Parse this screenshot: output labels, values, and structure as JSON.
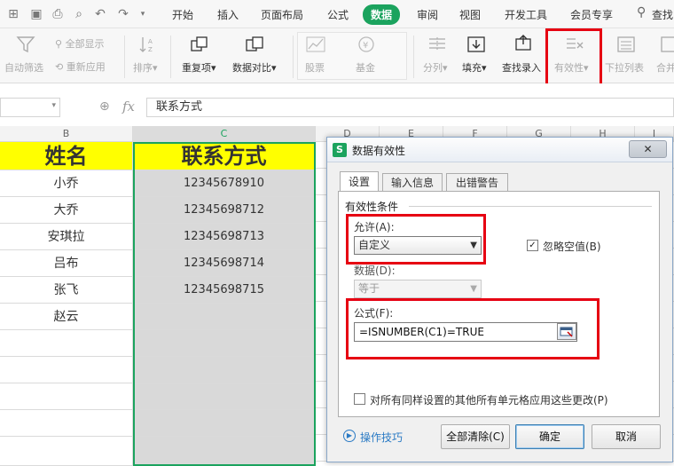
{
  "menu": {
    "tabs": [
      "开始",
      "插入",
      "页面布局",
      "公式",
      "数据",
      "审阅",
      "视图",
      "开发工具",
      "会员专享"
    ],
    "active_tab": "数据",
    "search_label": "查找"
  },
  "ribbon": {
    "auto_filter": "自动筛选",
    "show_all": "全部显示",
    "reapply": "重新应用",
    "sort": "排序",
    "duplicates": "重复项",
    "compare": "数据对比",
    "stocks": "股票",
    "funds": "基金",
    "split": "分列",
    "fill": "填充",
    "lookup_entry": "查找录入",
    "validity": "有效性",
    "dropdown_list": "下拉列表",
    "merge": "合并"
  },
  "formula_bar": {
    "fx": "fx",
    "content": "联系方式"
  },
  "sheet": {
    "columns": [
      "B",
      "C",
      "D",
      "E",
      "F",
      "G",
      "H",
      "I"
    ],
    "header_name": "姓名",
    "header_contact": "联系方式",
    "names": [
      "小乔",
      "大乔",
      "安琪拉",
      "吕布",
      "张飞",
      "赵云"
    ],
    "phones": [
      "12345678910",
      "12345698712",
      "12345698713",
      "12345698714",
      "12345698715"
    ]
  },
  "dialog": {
    "title": "数据有效性",
    "close": "✕",
    "tabs": [
      "设置",
      "输入信息",
      "出错警告"
    ],
    "section": "有效性条件",
    "allow_label": "允许(A):",
    "allow_value": "自定义",
    "ignore_blank": "忽略空值(B)",
    "data_label": "数据(D):",
    "data_value": "等于",
    "formula_label": "公式(F):",
    "formula_value": "=ISNUMBER(C1)=TRUE",
    "apply_all": "对所有同样设置的其他所有单元格应用这些更改(P)",
    "tips": "操作技巧",
    "clear_all": "全部清除(C)",
    "ok": "确定",
    "cancel": "取消"
  },
  "colors": {
    "accent": "#1ba35e",
    "highlight": "#e60012",
    "header_fill": "#ffff00",
    "selection": "#d9d9d9"
  }
}
